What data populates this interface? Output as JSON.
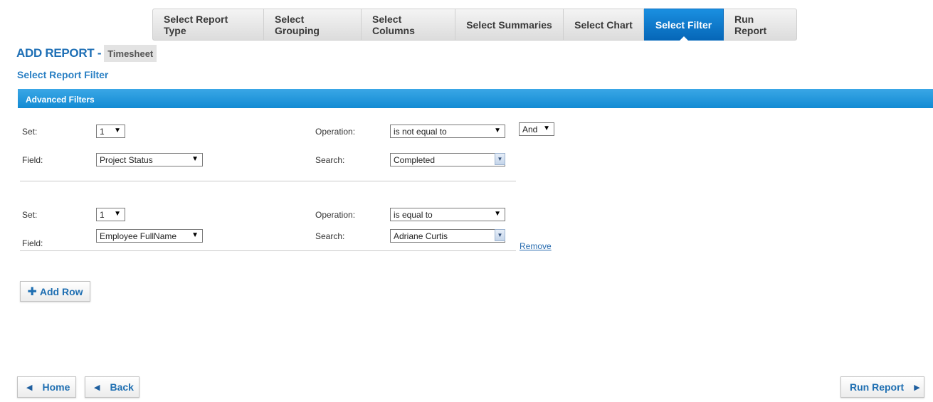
{
  "tabs": [
    {
      "label": "Select Report Type",
      "active": false
    },
    {
      "label": "Select Grouping",
      "active": false
    },
    {
      "label": "Select Columns",
      "active": false
    },
    {
      "label": "Select Summaries",
      "active": false
    },
    {
      "label": "Select Chart",
      "active": false
    },
    {
      "label": "Select Filter",
      "active": true
    },
    {
      "label": "Run Report",
      "active": false
    }
  ],
  "header": {
    "title": "ADD REPORT -",
    "report_type": "Timesheet",
    "subtitle": "Select Report Filter"
  },
  "section": {
    "title": "Advanced Filters"
  },
  "labels": {
    "set": "Set:",
    "field": "Field:",
    "operation": "Operation:",
    "search": "Search:"
  },
  "filters": [
    {
      "set": "1",
      "field": "Project Status",
      "operation": "is not equal to",
      "search": "Completed",
      "conjunction": "And"
    },
    {
      "set": "1",
      "field": "Employee FullName",
      "operation": "is equal to",
      "search": "Adriane Curtis",
      "remove_label": "Remove"
    }
  ],
  "buttons": {
    "add_row": "Add Row",
    "home": "Home",
    "back": "Back",
    "run_report": "Run Report"
  },
  "icons": {
    "plus": "plus-icon",
    "left": "triangle-left-icon",
    "right": "triangle-right-icon",
    "dropdown": "dropdown-arrow-icon"
  },
  "colors": {
    "accent": "#0a78cf",
    "section_bar": "#1e96dc",
    "title": "#1e6fb5"
  }
}
